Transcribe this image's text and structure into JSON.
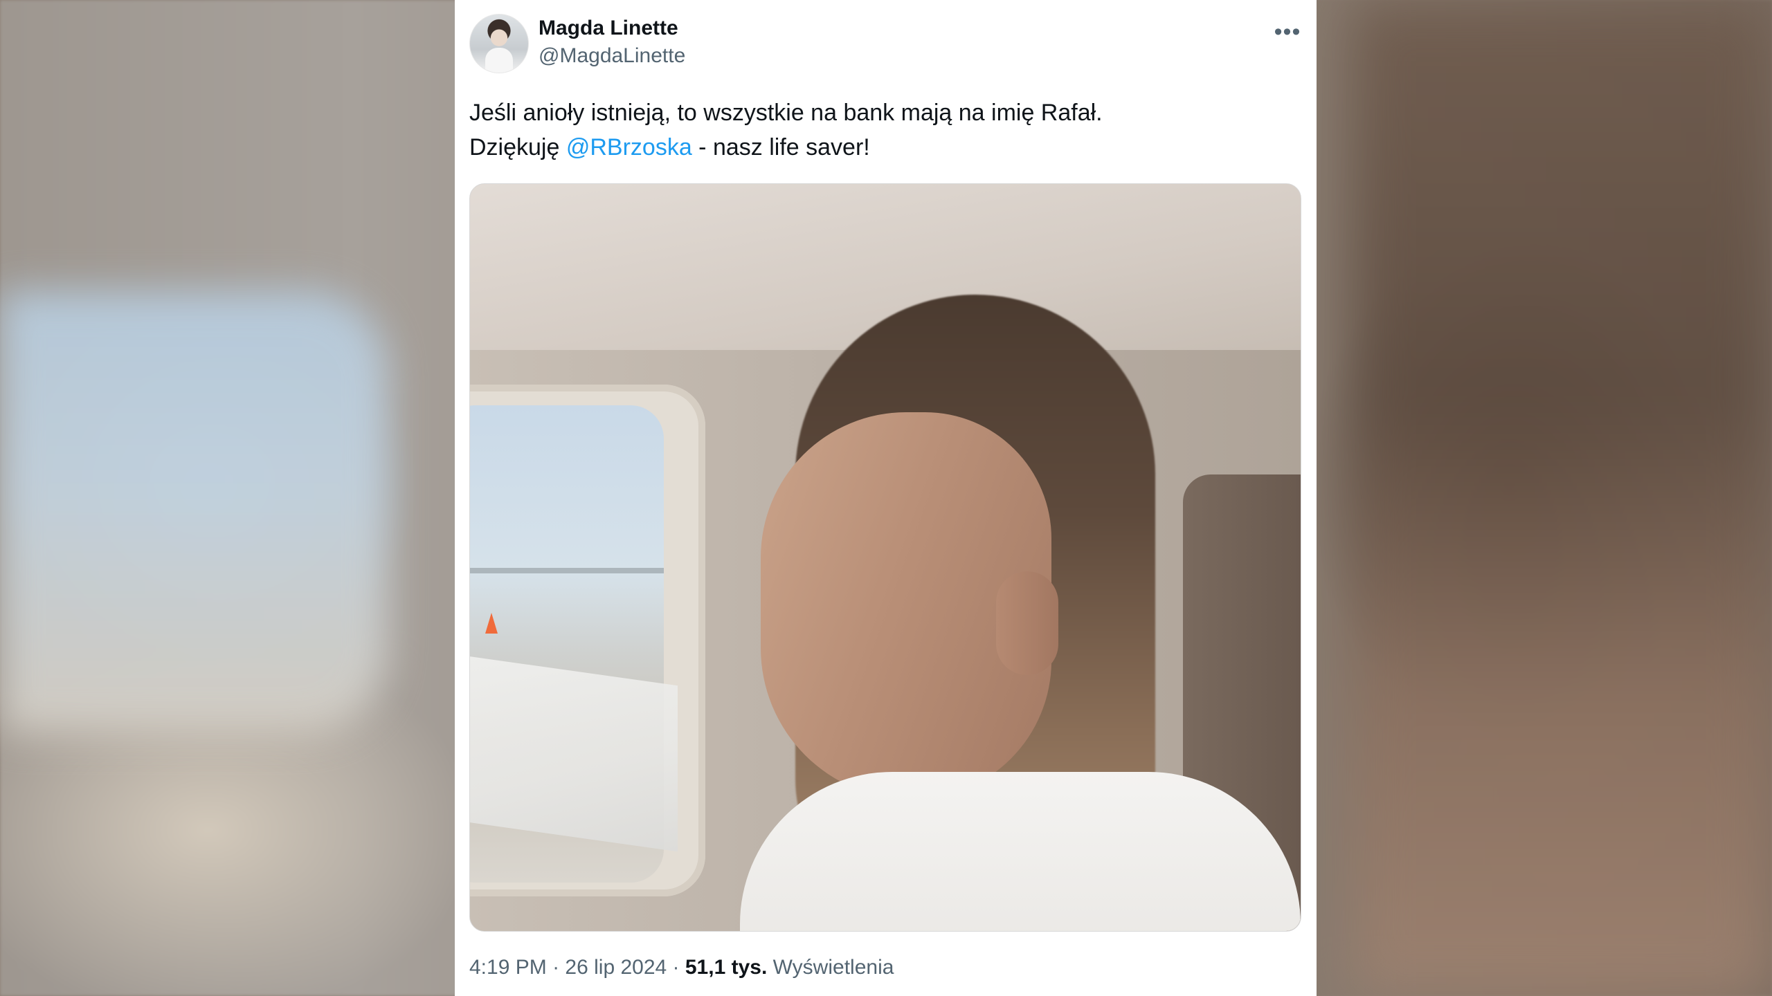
{
  "tweet": {
    "author": {
      "display_name": "Magda Linette",
      "handle": "@MagdaLinette",
      "avatar_icon": "profile-photo"
    },
    "more_icon": "more-options-icon",
    "more_label": "•••",
    "text": {
      "line1": "Jeśli anioły istnieją, to wszystkie na bank mają na imię Rafał.",
      "line2_prefix": "Dziękuję ",
      "mention": "@RBrzoska",
      "line2_suffix": " - nasz life saver!"
    },
    "meta": {
      "time": "4:19 PM",
      "sep1": " · ",
      "date": "26 lip 2024",
      "sep2": " · ",
      "views_count": "51,1 tys.",
      "views_label": " Wyświetlenia"
    },
    "colors": {
      "text": "#0f1419",
      "secondary": "#536471",
      "link": "#1d9bf0"
    }
  }
}
